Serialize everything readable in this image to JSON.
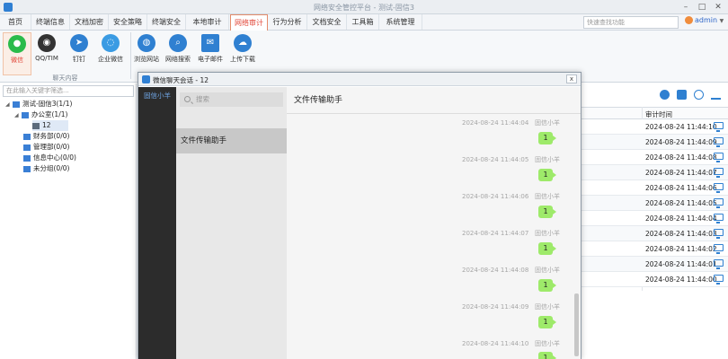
{
  "window": {
    "title": "网络安全管控平台 - 测试-固信3"
  },
  "menu": {
    "items": [
      "首页",
      "终端信息",
      "文档加密",
      "安全策略",
      "终端安全",
      "本地审计",
      "网络审计",
      "行为分析",
      "文档安全",
      "工具箱",
      "系统管理"
    ],
    "active_index": 6
  },
  "search": {
    "placeholder": "快速查找功能"
  },
  "user": {
    "name": "admin",
    "arrow": "▼"
  },
  "ribbon": {
    "buttons": [
      {
        "label": "微信",
        "icon": "wechat-icon",
        "color": "#2bbb4b"
      },
      {
        "label": "QQ/TIM",
        "icon": "qq-icon",
        "color": "#f2a52c"
      },
      {
        "label": "钉钉",
        "icon": "dingtalk-icon",
        "color": "#2f80d1"
      },
      {
        "label": "企业微信",
        "icon": "wecom-icon",
        "color": "#3a9be3"
      },
      {
        "label": "浏览网站",
        "icon": "globe-icon",
        "color": "#2f80d1"
      },
      {
        "label": "网络搜索",
        "icon": "globe-search-icon",
        "color": "#2f80d1"
      },
      {
        "label": "电子邮件",
        "icon": "email-icon",
        "color": "#2f80d1"
      },
      {
        "label": "上传下载",
        "icon": "cloud-transfer-icon",
        "color": "#2f80d1"
      }
    ],
    "group_label": "聊天内容"
  },
  "tree": {
    "search_placeholder": "在此输入关键字筛选...",
    "nodes": [
      {
        "label": "测试-固信3(1/1)",
        "toggle": "◢",
        "level": 0
      },
      {
        "label": "办公室(1/1)",
        "toggle": "◢",
        "level": 1
      },
      {
        "label": "12",
        "toggle": "",
        "level": 2
      },
      {
        "label": "财务部(0/0)",
        "toggle": "",
        "level": 1
      },
      {
        "label": "管理部(0/0)",
        "toggle": "",
        "level": 1
      },
      {
        "label": "信息中心(0/0)",
        "toggle": "",
        "level": 1
      },
      {
        "label": "未分组(0/0)",
        "toggle": "",
        "level": 1
      }
    ]
  },
  "table": {
    "header": "审计时间",
    "rows": [
      "2024-08-24 11:44:10",
      "2024-08-24 11:44:09",
      "2024-08-24 11:44:08",
      "2024-08-24 11:44:07",
      "2024-08-24 11:44:06",
      "2024-08-24 11:44:05",
      "2024-08-24 11:44:04",
      "2024-08-24 11:44:03",
      "2024-08-24 11:44:02",
      "2024-08-24 11:44:01",
      "2024-08-24 11:44:00"
    ]
  },
  "dialog": {
    "title": "微信聊天会话 - 12",
    "close": "x",
    "sidebar_label": "固信小羊",
    "search_placeholder": "搜索",
    "chat_item": "文件传输助手",
    "chat_header": "文件传输助手",
    "messages": [
      {
        "time": "2024-08-24 11:44:04",
        "sender": "固信小羊",
        "text": "1"
      },
      {
        "time": "2024-08-24 11:44:05",
        "sender": "固信小羊",
        "text": "1"
      },
      {
        "time": "2024-08-24 11:44:06",
        "sender": "固信小羊",
        "text": "1"
      },
      {
        "time": "2024-08-24 11:44:07",
        "sender": "固信小羊",
        "text": "1"
      },
      {
        "time": "2024-08-24 11:44:08",
        "sender": "固信小羊",
        "text": "1"
      },
      {
        "time": "2024-08-24 11:44:09",
        "sender": "固信小羊",
        "text": "1"
      },
      {
        "time": "2024-08-24 11:44:10",
        "sender": "固信小羊",
        "text": "1"
      }
    ]
  },
  "colors": {
    "accent": "#e2483a",
    "brand_blue": "#2f80d1",
    "bubble_green": "#9eea6a",
    "dialog_sidebar": "#2c2c2c"
  }
}
